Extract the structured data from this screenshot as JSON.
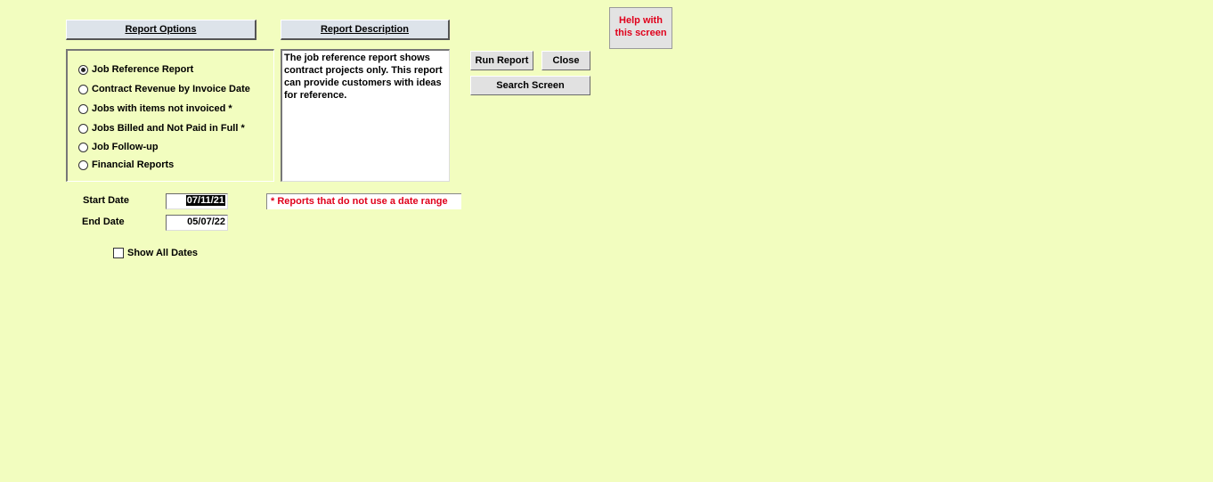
{
  "headers": {
    "report_options": "Report Options",
    "report_description": "Report Description"
  },
  "options": [
    {
      "label": "Job Reference Report",
      "selected": true
    },
    {
      "label": "Contract Revenue by Invoice Date",
      "selected": false
    },
    {
      "label": "Jobs with items not invoiced *",
      "selected": false
    },
    {
      "label": "Jobs Billed and Not Paid in Full *",
      "selected": false
    },
    {
      "label": "Job Follow-up",
      "selected": false
    },
    {
      "label": "Financial Reports",
      "selected": false
    }
  ],
  "description": "The job reference report shows contract projects only.  This report can provide customers with ideas for reference.",
  "buttons": {
    "run_report": "Run Report",
    "close": "Close",
    "search_screen": "Search Screen",
    "help_line1": "Help with",
    "help_line2": "this screen"
  },
  "dates": {
    "start_label": "Start Date",
    "start_value": "07/11/21",
    "end_label": "End Date",
    "end_value": "05/07/22"
  },
  "note": "* Reports that do not use a date range",
  "show_all_dates": {
    "label": "Show All Dates",
    "checked": false
  },
  "colors": {
    "background": "#f2fdbf",
    "note_red": "#e0001b"
  }
}
